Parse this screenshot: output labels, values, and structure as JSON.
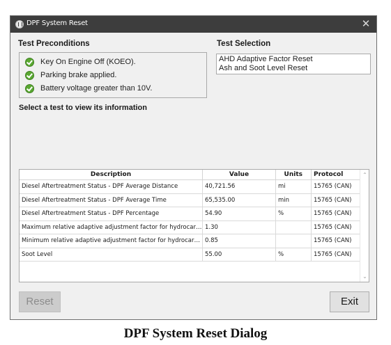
{
  "window": {
    "title": "DPF System Reset",
    "close_glyph": "✕",
    "app_icon": "app-logo-icon",
    "close_icon": "close-icon"
  },
  "preconditions": {
    "heading": "Test Preconditions",
    "items": [
      {
        "label": "Key On Engine Off (KOEO).",
        "icon": "check-circle-icon",
        "status_color": "#5aa832"
      },
      {
        "label": "Parking brake applied.",
        "icon": "check-circle-icon",
        "status_color": "#5aa832"
      },
      {
        "label": "Battery voltage greater than 10V.",
        "icon": "check-circle-icon",
        "status_color": "#5aa832"
      }
    ]
  },
  "test_selection": {
    "heading": "Test Selection",
    "tests": [
      "AHD Adaptive Factor Reset",
      "Ash and Soot Level Reset"
    ]
  },
  "info_prompt": "Select a test to view its information",
  "table": {
    "columns": [
      "Description",
      "Value",
      "Units",
      "Protocol"
    ],
    "rows": [
      {
        "description": "Diesel Aftertreatment Status - DPF Average Distance",
        "value": "40,721.56",
        "units": "mi",
        "protocol": "15765 (CAN)"
      },
      {
        "description": "Diesel Aftertreatment Status - DPF Average Time",
        "value": "65,535.00",
        "units": "min",
        "protocol": "15765 (CAN)"
      },
      {
        "description": "Diesel Aftertreatment Status - DPF Percentage",
        "value": "54.90",
        "units": "%",
        "protocol": "15765 (CAN)"
      },
      {
        "description": "Maximum relative adaptive adjustment factor for hydrocarbon i...",
        "value": "1.30",
        "units": "",
        "protocol": "15765 (CAN)"
      },
      {
        "description": "Minimum relative adaptive adjustment factor for hydrocarbon i...",
        "value": "0.85",
        "units": "",
        "protocol": "15765 (CAN)"
      },
      {
        "description": "Soot Level",
        "value": "55.00",
        "units": "%",
        "protocol": "15765 (CAN)"
      }
    ],
    "scroll_up_glyph": "⌃",
    "scroll_down_glyph": "⌄"
  },
  "buttons": {
    "reset": "Reset",
    "exit": "Exit"
  },
  "caption": "DPF System Reset Dialog"
}
